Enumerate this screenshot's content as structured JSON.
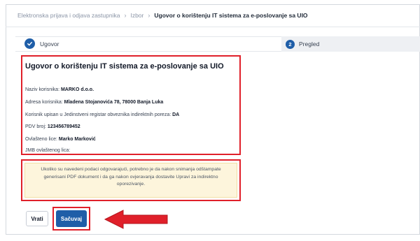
{
  "breadcrumb": {
    "items": [
      "Elektronska prijava i odjava zastupnika",
      "Izbor"
    ],
    "current": "Ugovor o korištenju IT sistema za e-poslovanje sa UIO"
  },
  "steps": [
    {
      "label": "Ugovor",
      "state": "done",
      "icon": "check-icon"
    },
    {
      "label": "Pregled",
      "number": "2",
      "state": "active"
    }
  ],
  "info": {
    "title": "Ugovor o korištenju IT sistema za e-poslovanje sa UIO",
    "rows": [
      {
        "label": "Naziv korisnika:",
        "value": "MARKO d.o.o."
      },
      {
        "label": "Adresa korisnika:",
        "value": "Mladena Stojanovića 78, 78000 Banja Luka"
      },
      {
        "label": "Korisnik upisan u Jedinstveni registar obveznika indirektnih poreza:",
        "value": "DA"
      },
      {
        "label": "PDV broj:",
        "value": "123456789452"
      },
      {
        "label": "Ovlašteno lice:",
        "value": "Marko Marković"
      },
      {
        "label": "JMB ovlaštenog lica:",
        "value": ""
      }
    ]
  },
  "note": "Ukoliko su navedeni podaci odgovarajući, potrebno je da nakon snimanja odštampate generisani PDF dokument i da ga nakon ovjeravanja dostavite Upravi za indirektno oporezivanje.",
  "buttons": {
    "back": "Vrati",
    "save": "Sačuvaj"
  },
  "colors": {
    "primary": "#1f5ea8",
    "highlight": "#e0202a",
    "note_bg": "#fdf5dc"
  }
}
